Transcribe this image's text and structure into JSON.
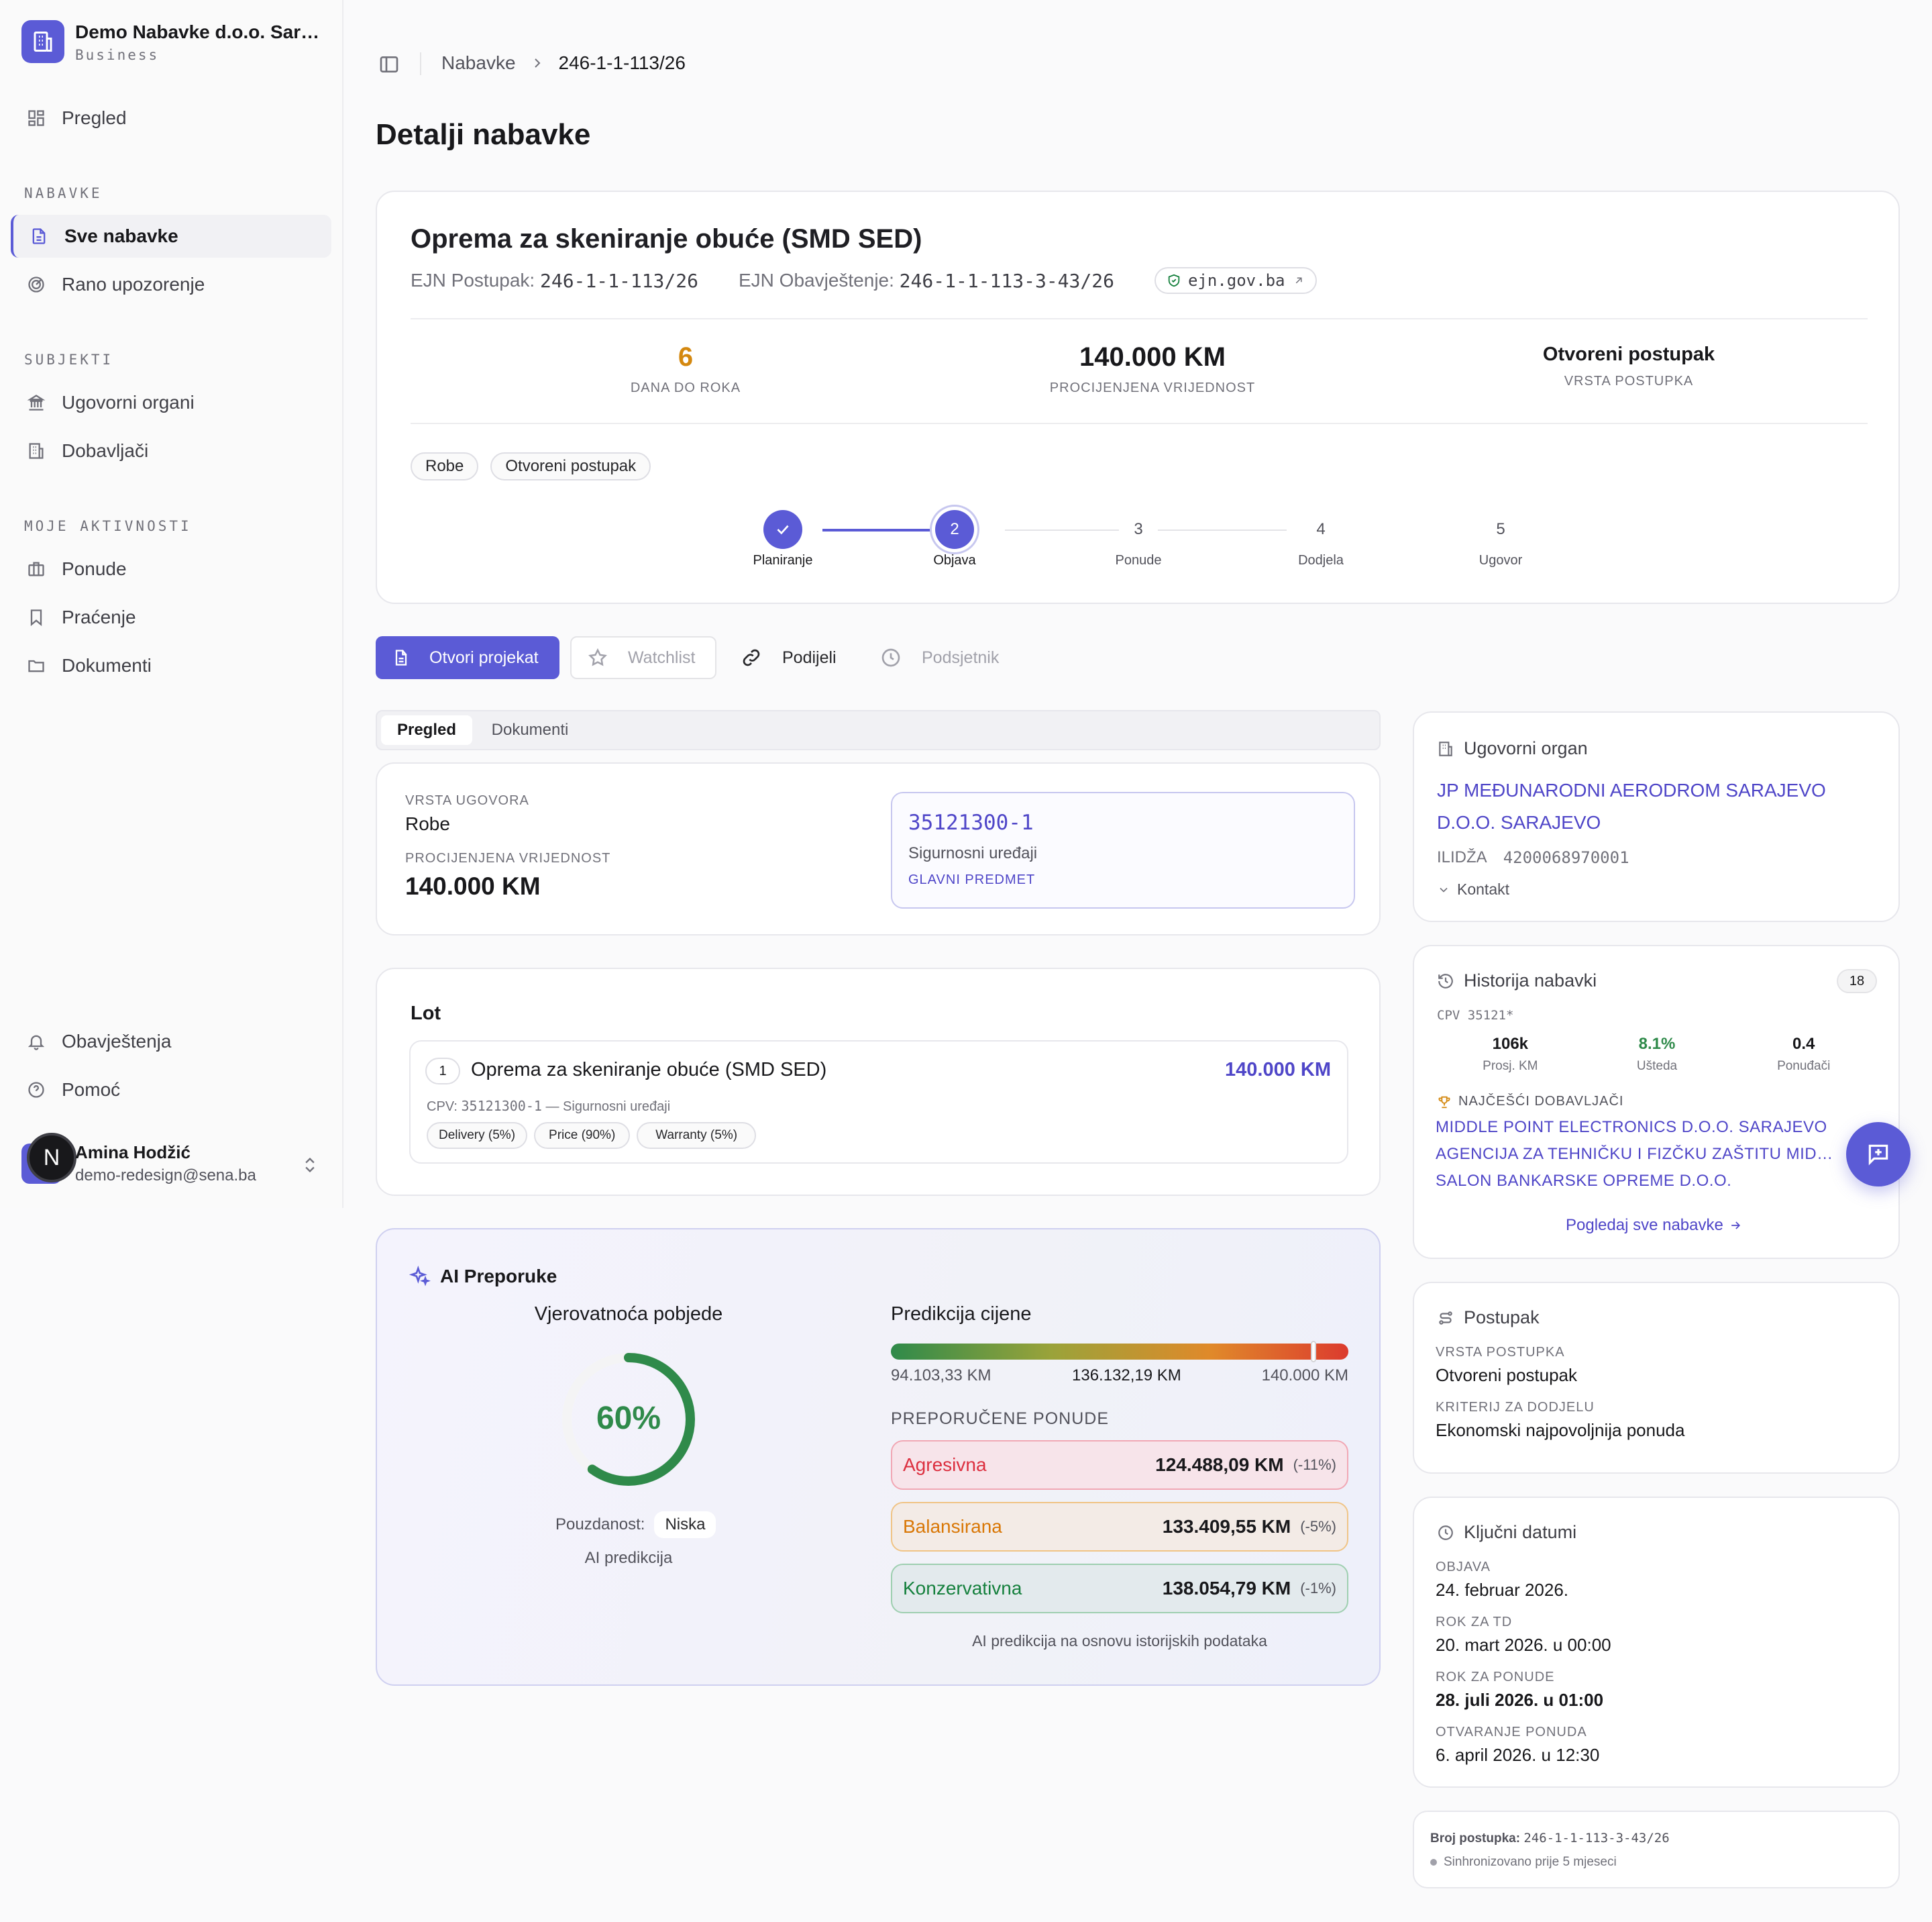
{
  "org": {
    "name": "Demo Nabavke d.o.o. Sarajevo",
    "plan": "Business"
  },
  "nav": {
    "overview": "Pregled",
    "section_procurements": "NABAVKE",
    "all_procurements": "Sve nabavke",
    "early_warning": "Rano upozorenje",
    "section_subjects": "SUBJEKTI",
    "contracting_bodies": "Ugovorni organi",
    "suppliers": "Dobavljači",
    "section_activities": "MOJE AKTIVNOSTI",
    "bids": "Ponude",
    "tracking": "Praćenje",
    "documents": "Dokumenti",
    "notifications": "Obavještenja",
    "help": "Pomoć"
  },
  "user": {
    "name": "Amina Hodžić",
    "email": "demo-redesign@sena.ba",
    "badge": "N"
  },
  "breadcrumb": {
    "parent": "Nabavke",
    "current": "246-1-1-113/26"
  },
  "page_title": "Detalji nabavke",
  "tender": {
    "title": "Oprema za skeniranje obuće (SMD SED)",
    "procedure_label": "EJN Postupak:",
    "procedure_no": "246-1-1-113/26",
    "notice_label": "EJN Obavještenje:",
    "notice_no": "246-1-1-113-3-43/26",
    "source_link": "ejn.gov.ba",
    "days_left": "6",
    "days_left_label": "DANA DO ROKA",
    "estimated_value": "140.000 KM",
    "estimated_value_label": "PROCIJENJENA VRIJEDNOST",
    "procedure_type": "Otvoreni postupak",
    "procedure_type_label": "VRSTA POSTUPKA",
    "tags": [
      "Robe",
      "Otvoreni postupak"
    ]
  },
  "stepper": {
    "steps": [
      {
        "num": "",
        "label": "Planiranje"
      },
      {
        "num": "2",
        "label": "Objava"
      },
      {
        "num": "3",
        "label": "Ponude"
      },
      {
        "num": "4",
        "label": "Dodjela"
      },
      {
        "num": "5",
        "label": "Ugovor"
      }
    ],
    "current_step": 2
  },
  "actions": {
    "open_project": "Otvori projekat",
    "watchlist": "Watchlist",
    "share": "Podijeli",
    "reminder": "Podsjetnik"
  },
  "tabs": {
    "overview": "Pregled",
    "documents": "Dokumenti"
  },
  "summary": {
    "contract_type_label": "VRSTA UGOVORA",
    "contract_type": "Robe",
    "value_label": "PROCIJENJENA VRIJEDNOST",
    "value": "140.000 KM",
    "cpv_code": "35121300-1",
    "cpv_name": "Sigurnosni uređaji",
    "cpv_tag": "GLAVNI PREDMET"
  },
  "lot": {
    "heading": "Lot",
    "number": "1",
    "title": "Oprema za skeniranje obuće (SMD SED)",
    "value": "140.000 KM",
    "cpv_prefix": "CPV:",
    "cpv_code": "35121300-1",
    "cpv_desc": "— Sigurnosni uređaji",
    "criteria": [
      "Delivery (5%)",
      "Price (90%)",
      "Warranty (5%)"
    ]
  },
  "ai": {
    "heading": "AI Preporuke",
    "win_title": "Vjerovatnoća pobjede",
    "win_probability": 60,
    "win_text": "60%",
    "confidence_label": "Pouzdanost:",
    "confidence": "Niska",
    "prediction_note": "AI predikcija",
    "price_title": "Predikcija cijene",
    "price_min": "94.103,33 KM",
    "price_pred": "136.132,19 KM",
    "price_max": "140.000 KM",
    "marker_fraction": 0.918,
    "recommended_title": "PREPORUČENE PONUDE",
    "offers": [
      {
        "name": "Agresivna",
        "value": "124.488,09 KM",
        "pct": "(-11%)"
      },
      {
        "name": "Balansirana",
        "value": "133.409,55 KM",
        "pct": "(-5%)"
      },
      {
        "name": "Konzervativna",
        "value": "138.054,79 KM",
        "pct": "(-1%)"
      }
    ],
    "footnote": "AI predikcija na osnovu istorijskih podataka",
    "colors": {
      "aggressive": "#dc2f3f",
      "balanced": "#d97706",
      "conservative": "#15803d",
      "gauge": "#2f8a4a"
    }
  },
  "buyer": {
    "heading": "Ugovorni organ",
    "name_line1": "JP MEĐUNARODNI AERODROM SARAJEVO",
    "name_line2": "D.O.O. SARAJEVO",
    "city": "ILIDŽA",
    "id": "4200068970001",
    "contact": "Kontakt"
  },
  "history": {
    "heading": "Historija nabavki",
    "count": "18",
    "cpv": "CPV 35121*",
    "stats": [
      {
        "value": "106k",
        "label": "Prosj. KM"
      },
      {
        "value": "8.1%",
        "label": "Ušteda"
      },
      {
        "value": "0.4",
        "label": "Ponuđači"
      }
    ],
    "top_suppliers_label": "NAJČEŠĆI DOBAVLJAČI",
    "suppliers": [
      "MIDDLE POINT ELECTRONICS D.O.O. SARAJEVO",
      "AGENCIJA ZA TEHNIČKU I FIZČKU ZAŠTITU MIDDLE POINT",
      "SALON BANKARSKE OPREME D.O.O."
    ],
    "view_all": "Pogledaj sve nabavke"
  },
  "procedure": {
    "heading": "Postupak",
    "type_label": "VRSTA POSTUPKA",
    "type": "Otvoreni postupak",
    "criteria_label": "KRITERIJ ZA DODJELU",
    "criteria": "Ekonomski najpovoljnija ponuda"
  },
  "dates": {
    "heading": "Ključni datumi",
    "items": [
      {
        "label": "OBJAVA",
        "value": "24. februar 2026."
      },
      {
        "label": "ROK ZA TD",
        "value": "20. mart 2026. u 00:00"
      },
      {
        "label": "ROK ZA PONUDE",
        "value": "28. juli 2026. u 01:00"
      },
      {
        "label": "OTVARANJE PONUDA",
        "value": "6. april 2026. u 12:30"
      }
    ]
  },
  "footer": {
    "number_label": "Broj postupka:",
    "number": "246-1-1-113-3-43/26",
    "sync": "Sinhronizovano prije 5 mjeseci"
  },
  "accent": "#5b5bd6"
}
